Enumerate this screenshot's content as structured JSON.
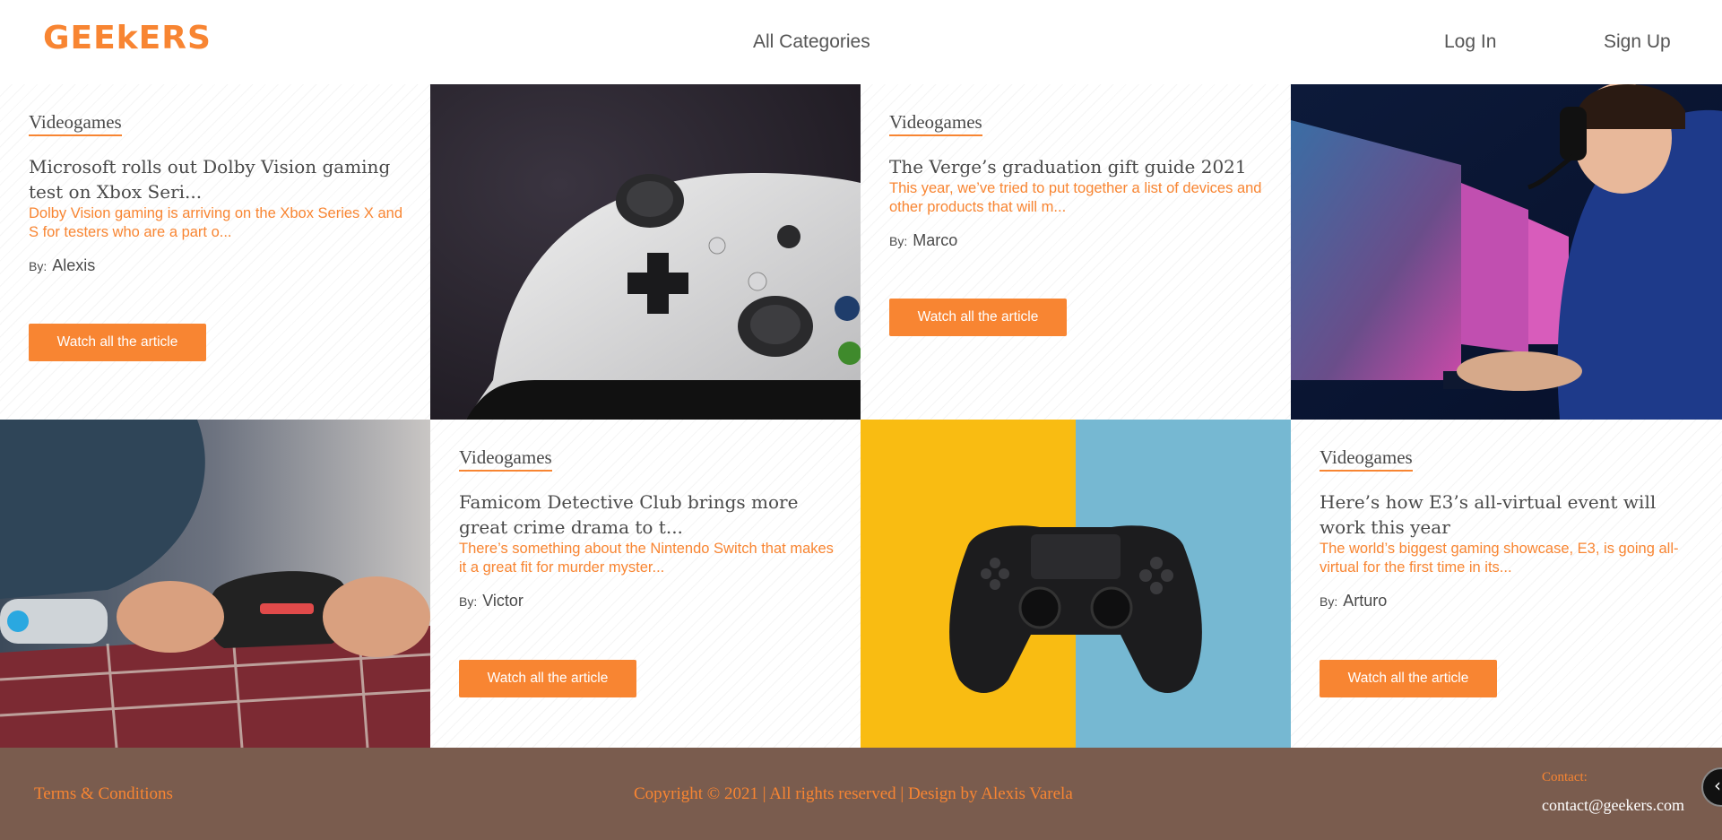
{
  "brand": {
    "logo_text": "GEEkERS",
    "accent_color": "#f88532"
  },
  "nav": {
    "categories": "All Categories",
    "login": "Log In",
    "signup": "Sign Up"
  },
  "articles": [
    {
      "category": "Videogames",
      "title": "Microsoft rolls out Dolby Vision gaming test on Xbox Seri...",
      "excerpt": "Dolby Vision gaming is arriving on the Xbox Series X and S for testers who are a part o...",
      "by_label": "By:",
      "author": "Alexis",
      "button": "Watch all the article"
    },
    {
      "category": "Videogames",
      "title": "The Verge’s graduation gift guide 2021",
      "excerpt": "This year, we’ve tried to put together a list of devices and other products that will m...",
      "by_label": "By:",
      "author": "Marco",
      "button": "Watch all the article"
    },
    {
      "category": "Videogames",
      "title": "Famicom Detective Club brings more great crime drama to t...",
      "excerpt": "There’s something about the Nintendo Switch that makes it a great fit for murder myster...",
      "by_label": "By:",
      "author": "Victor",
      "button": "Watch all the article"
    },
    {
      "category": "Videogames",
      "title": "Here’s how E3’s all-virtual event will work this year",
      "excerpt": "The world’s biggest gaming showcase, E3, is going all-virtual for the first time in its...",
      "by_label": "By:",
      "author": "Arturo",
      "button": "Watch all the article"
    }
  ],
  "images": {
    "img1": "xbox-controller-photo",
    "img2": "gamer-with-headset-photo",
    "img3": "hands-holding-controller-photo",
    "img4": "playstation-controller-photo"
  },
  "footer": {
    "terms": "Terms & Conditions",
    "copyright": "Copyright © 2021 | All rights reserved | Design by Alexis Varela",
    "contact_label": "Contact:",
    "contact_email": "contact@geekers.com",
    "background_color": "#7a5c4e"
  }
}
